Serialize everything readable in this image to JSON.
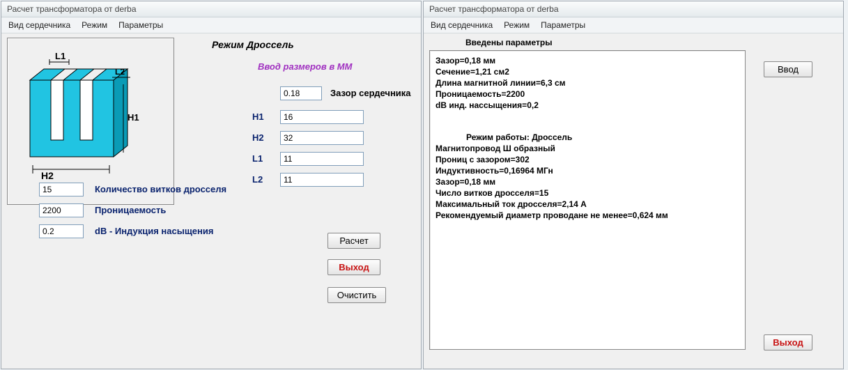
{
  "left": {
    "title": "Расчет трансформатора от derba",
    "menu": {
      "core": "Вид сердечника",
      "mode": "Режим",
      "params": "Параметры"
    },
    "mode_title": "Режим Дроссель",
    "size_hint": "Ввод размеров в ММ",
    "rows": {
      "gap": {
        "label": "Зазор сердечника",
        "value": "0.18"
      },
      "h1": {
        "label": "H1",
        "value": "16"
      },
      "h2": {
        "label": "H2",
        "value": "32"
      },
      "l1": {
        "label": "L1",
        "value": "11"
      },
      "l2": {
        "label": "L2",
        "value": "11"
      }
    },
    "below": {
      "turns": {
        "label": "Количество витков дросселя",
        "value": "15"
      },
      "perm": {
        "label": "Проницаемость",
        "value": "2200"
      },
      "dbind": {
        "label": "dB - Индукция насыщения",
        "value": "0.2"
      }
    },
    "buttons": {
      "calc": "Расчет",
      "exit": "Выход",
      "clear": "Очистить"
    },
    "core_labels": {
      "l1": "L1",
      "l2": "L2",
      "h1": "H1",
      "h2": "H2"
    }
  },
  "right": {
    "title": "Расчет трансформатора от derba",
    "menu": {
      "core": "Вид сердечника",
      "mode": "Режим",
      "params": "Параметры"
    },
    "params_title": "Введены параметры",
    "lines": [
      "Зазор=0,18 мм",
      "Сечение=1,21 см2",
      "Длина магнитной линии=6,3 см",
      "Проницаемость=2200",
      "dB инд. нассыщения=0,2"
    ],
    "mode_line": "Режим работы: Дроссель",
    "lines2": [
      "Магнитопровод Ш образный",
      "Прониц с зазором=302",
      "Индуктивность=0,16964 МГн",
      "Зазор=0,18 мм",
      "Число витков дросселя=15",
      "Максимальный ток дросселя=2,14 А",
      "Рекомендуемый диаметр проводане не менее=0,624 мм"
    ],
    "buttons": {
      "enter": "Ввод",
      "exit": "Выход"
    }
  }
}
